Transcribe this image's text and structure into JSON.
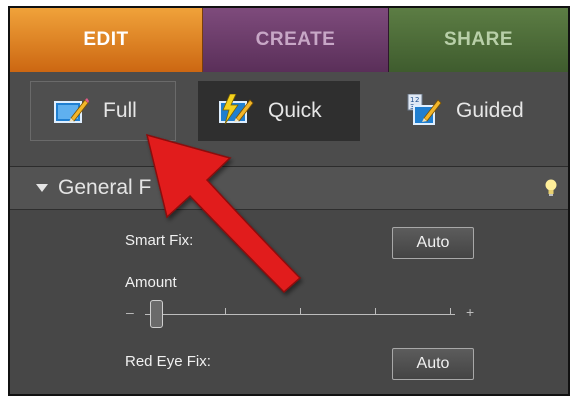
{
  "tabs": {
    "edit": "EDIT",
    "create": "CREATE",
    "share": "SHARE"
  },
  "modes": {
    "full": "Full",
    "quick": "Quick",
    "guided": "Guided"
  },
  "panel": {
    "title": "General F"
  },
  "fixes": {
    "smart_fix_label": "Smart Fix:",
    "smart_fix_button": "Auto",
    "amount_label": "Amount",
    "slider_minus": "–",
    "slider_plus": "+",
    "red_eye_label": "Red Eye Fix:",
    "red_eye_button": "Auto"
  },
  "colors": {
    "edit_tab": "#cc6712",
    "create_tab": "#5a2f59",
    "share_tab": "#3f5c2e",
    "arrow": "#e11d1d"
  },
  "icons": {
    "full": "photo-pencil-icon",
    "quick": "lightning-photo-pencil-icon",
    "guided": "numbered-photo-pencil-icon",
    "tip": "lightbulb-icon"
  }
}
